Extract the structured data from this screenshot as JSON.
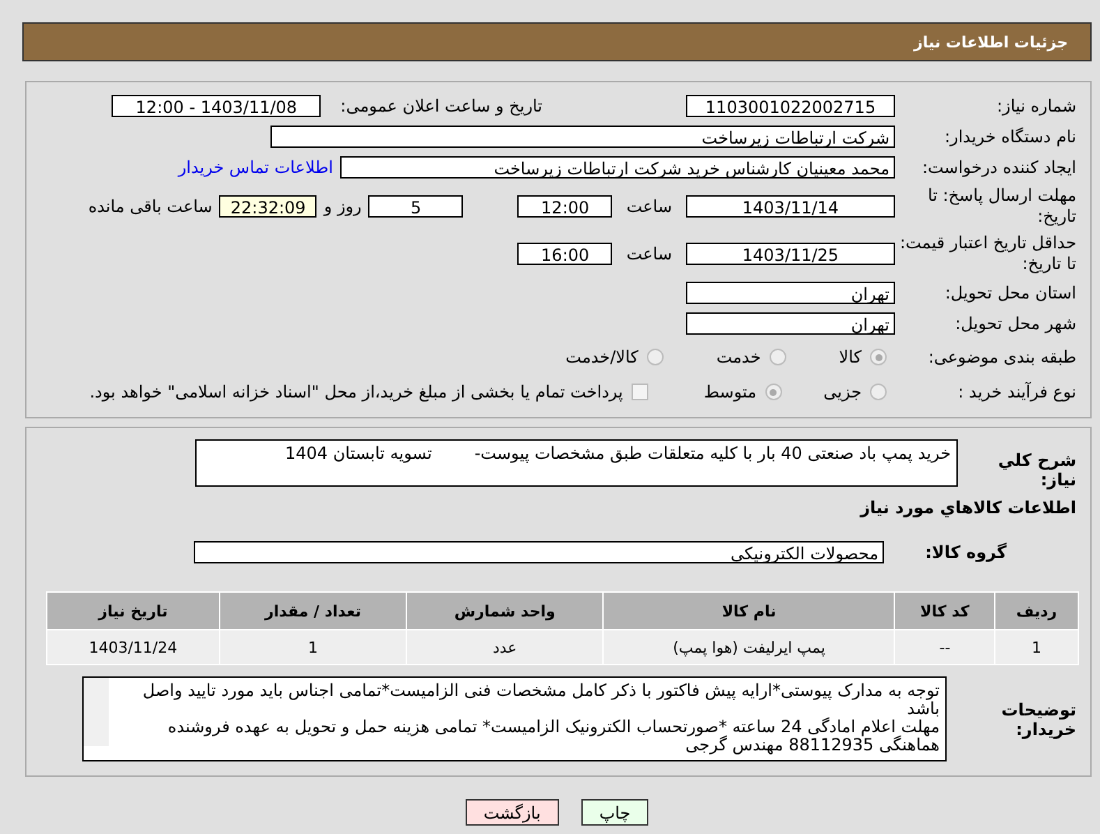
{
  "header": {
    "title": "جزئیات اطلاعات نیاز"
  },
  "need_number": {
    "label": "شماره نیاز:",
    "value": "1103001022002715"
  },
  "announce": {
    "label": "تاریخ و ساعت اعلان عمومی:",
    "value": "1403/11/08 - 12:00"
  },
  "buyer_org": {
    "label": "نام دستگاه خریدار:",
    "value": "شرکت ارتباطات زیرساخت"
  },
  "requester": {
    "label": "ایجاد کننده درخواست:",
    "value": "محمد معینیان کارشناس خرید شرکت ارتباطات زیرساخت",
    "link": "اطلاعات تماس خریدار"
  },
  "reply_deadline": {
    "label": "مهلت ارسال پاسخ: تا تاریخ:",
    "date": "1403/11/14",
    "time_label": "ساعت",
    "time": "12:00",
    "days": "5",
    "days_label": "روز و",
    "remaining": "22:32:09",
    "remaining_label": "ساعت باقی مانده"
  },
  "price_validity": {
    "label": "حداقل تاریخ اعتبار قیمت: تا تاریخ:",
    "date": "1403/11/25",
    "time_label": "ساعت",
    "time": "16:00"
  },
  "province": {
    "label": "استان محل تحویل:",
    "value": "تهران"
  },
  "city": {
    "label": "شهر محل تحویل:",
    "value": "تهران"
  },
  "category": {
    "label": "طبقه بندی موضوعی:",
    "options": [
      {
        "label": "کالا",
        "selected": true
      },
      {
        "label": "خدمت",
        "selected": false
      },
      {
        "label": "کالا/خدمت",
        "selected": false
      }
    ]
  },
  "process": {
    "label": "نوع فرآیند خرید :",
    "options": [
      {
        "label": "جزیی",
        "selected": false
      },
      {
        "label": "متوسط",
        "selected": true
      }
    ],
    "payment": {
      "label": "پرداخت تمام یا بخشی از مبلغ خرید،از محل \"اسناد خزانه اسلامی\" خواهد بود.",
      "checked": false
    }
  },
  "description": {
    "label": "شرح کلي نياز:",
    "value": "خرید پمپ باد صنعتی 40 بار با کلیه متعلقات طبق مشخصات پیوست-        تسویه تابستان 1404"
  },
  "goods_title": "اطلاعات كالاهاي مورد نياز",
  "goods_group": {
    "label": "گروه کالا:",
    "value": "محصولات الکترونیکی"
  },
  "table": {
    "columns": [
      "ردیف",
      "کد کالا",
      "نام کالا",
      "واحد شمارش",
      "تعداد / مقدار",
      "تاریخ نیاز"
    ],
    "rows": [
      [
        "1",
        "--",
        "پمپ ایرلیفت (هوا پمپ)",
        "عدد",
        "1",
        "1403/11/24"
      ]
    ]
  },
  "buyer_notes": {
    "label": "توضیحات خریدار:",
    "value": "توجه به مدارک پیوستی*ارایه پیش فاکتور با ذکر کامل مشخصات فنی الزامیست*تمامی اجناس باید مورد تایید واصل باشد\nمهلت اعلام امادگی 24 ساعته *صورتحساب الکترونیک الزامیست* تمامی هزینه حمل و تحویل به عهده فروشنده\nهماهنگی 88112935 مهندس گرجی"
  },
  "buttons": [
    {
      "label": "چاپ",
      "kind": "print"
    },
    {
      "label": "بازگشت",
      "kind": "back"
    }
  ]
}
